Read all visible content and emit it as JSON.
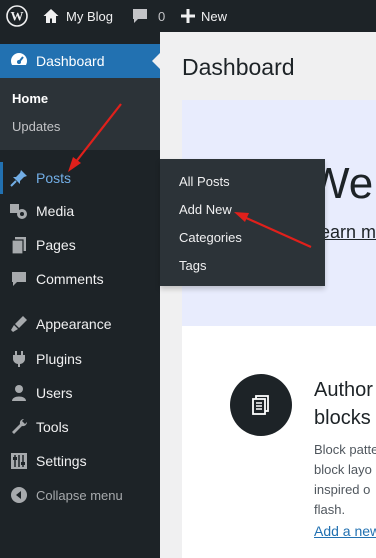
{
  "adminbar": {
    "site_name": "My Blog",
    "comments_count": "0",
    "new_label": "New"
  },
  "sidebar": {
    "dashboard": {
      "label": "Dashboard",
      "submenu": [
        "Home",
        "Updates"
      ]
    },
    "items": [
      {
        "label": "Posts",
        "icon": "pin-icon"
      },
      {
        "label": "Media",
        "icon": "media-icon"
      },
      {
        "label": "Pages",
        "icon": "pages-icon"
      },
      {
        "label": "Comments",
        "icon": "comments-icon"
      },
      {
        "label": "Appearance",
        "icon": "appearance-icon"
      },
      {
        "label": "Plugins",
        "icon": "plugins-icon"
      },
      {
        "label": "Users",
        "icon": "users-icon"
      },
      {
        "label": "Tools",
        "icon": "tools-icon"
      },
      {
        "label": "Settings",
        "icon": "settings-icon"
      }
    ],
    "collapse_label": "Collapse menu"
  },
  "posts_flyout": {
    "items": [
      "All Posts",
      "Add New",
      "Categories",
      "Tags"
    ]
  },
  "main": {
    "title": "Dashboard",
    "welcome_heading": "Welco",
    "welcome_link": "Learn more abou",
    "card": {
      "title_lines": [
        "Author",
        "blocks"
      ],
      "desc_lines": [
        "Block patte",
        "block layo",
        "inspired o",
        "flash."
      ],
      "link": "Add a new"
    }
  },
  "colors": {
    "admin_dark": "#1d2327",
    "accent": "#2271b1",
    "submenu_bg": "#2c3338",
    "highlight_text": "#72aee6",
    "annotation_arrow": "#e0201b",
    "welcome_bg": "#e8ecfd"
  }
}
